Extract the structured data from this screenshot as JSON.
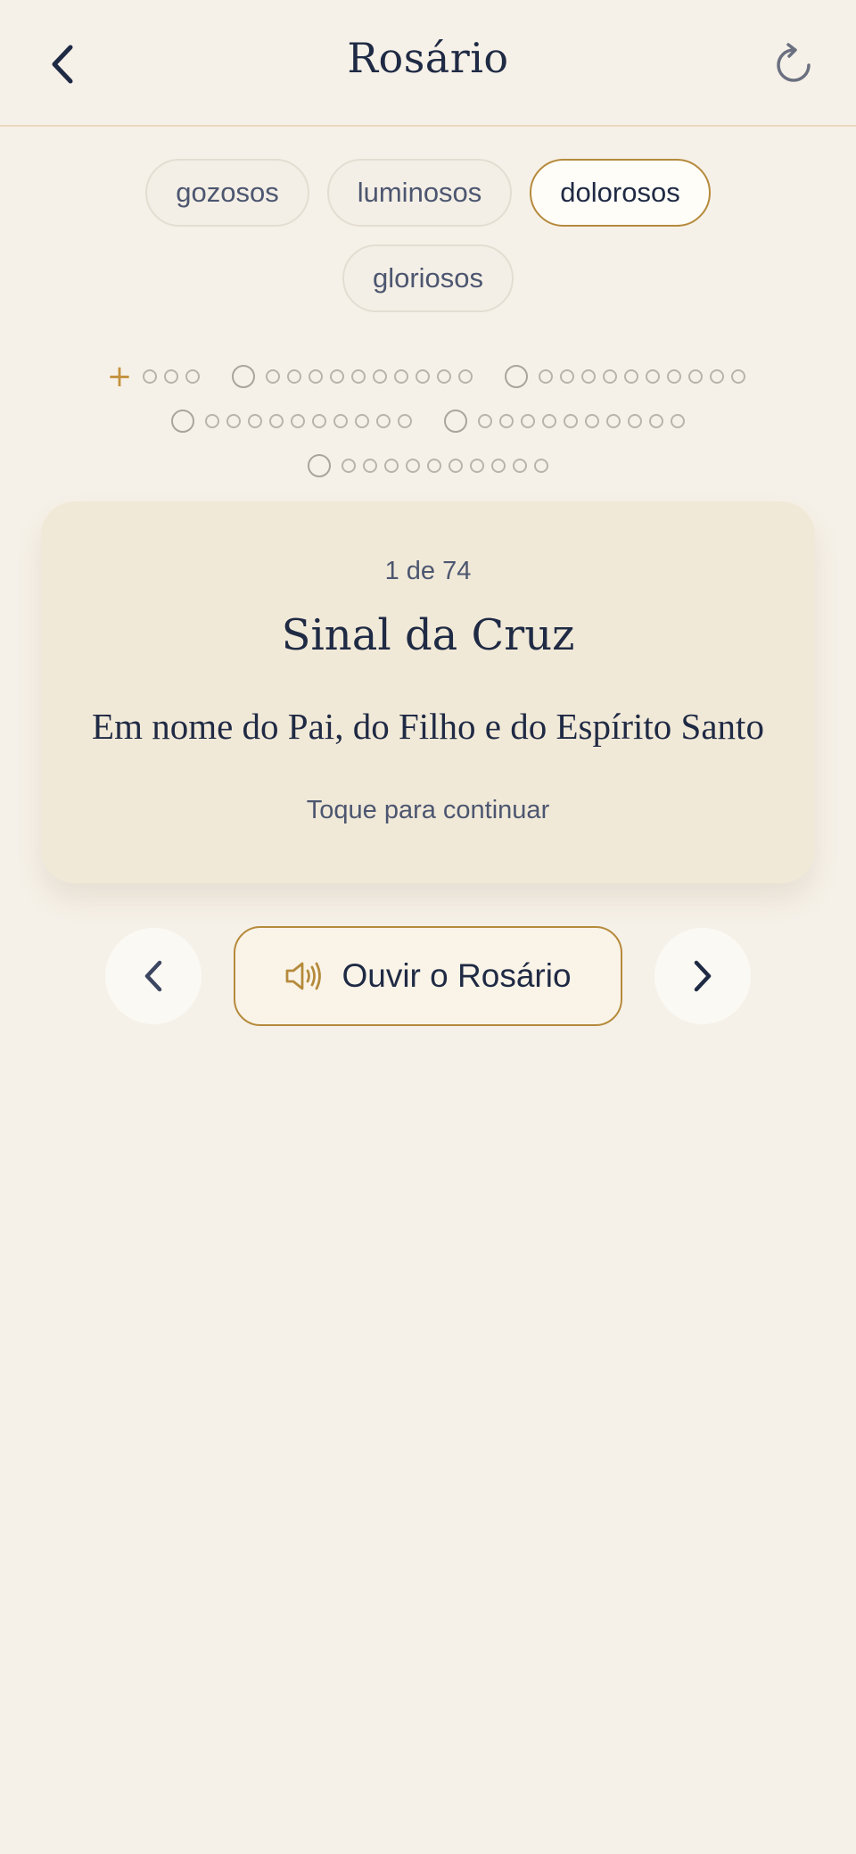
{
  "header": {
    "title": "Rosário",
    "back_icon": "chevron-left-icon",
    "reset_icon": "refresh-icon"
  },
  "mysteries": {
    "options": [
      "gozosos",
      "luminosos",
      "dolorosos",
      "gloriosos"
    ],
    "selected": "dolorosos"
  },
  "rosary": {
    "cross_symbol": "+",
    "intro_small_beads": 3,
    "decades": 5,
    "beads_per_decade": 10,
    "current_bead": 1
  },
  "card": {
    "progress": "1 de 74",
    "title": "Sinal da Cruz",
    "text": "Em nome do Pai, do Filho e do Espírito Santo",
    "hint": "Toque para continuar"
  },
  "controls": {
    "listen_label": "Ouvir o Rosário",
    "listen_icon": "speaker-icon",
    "prev_icon": "chevron-left-icon",
    "next_icon": "chevron-right-icon"
  },
  "colors": {
    "background": "#f6f1e8",
    "accent": "#b58a3c",
    "navy": "#1f2a44",
    "card": "#f1e9d8"
  }
}
